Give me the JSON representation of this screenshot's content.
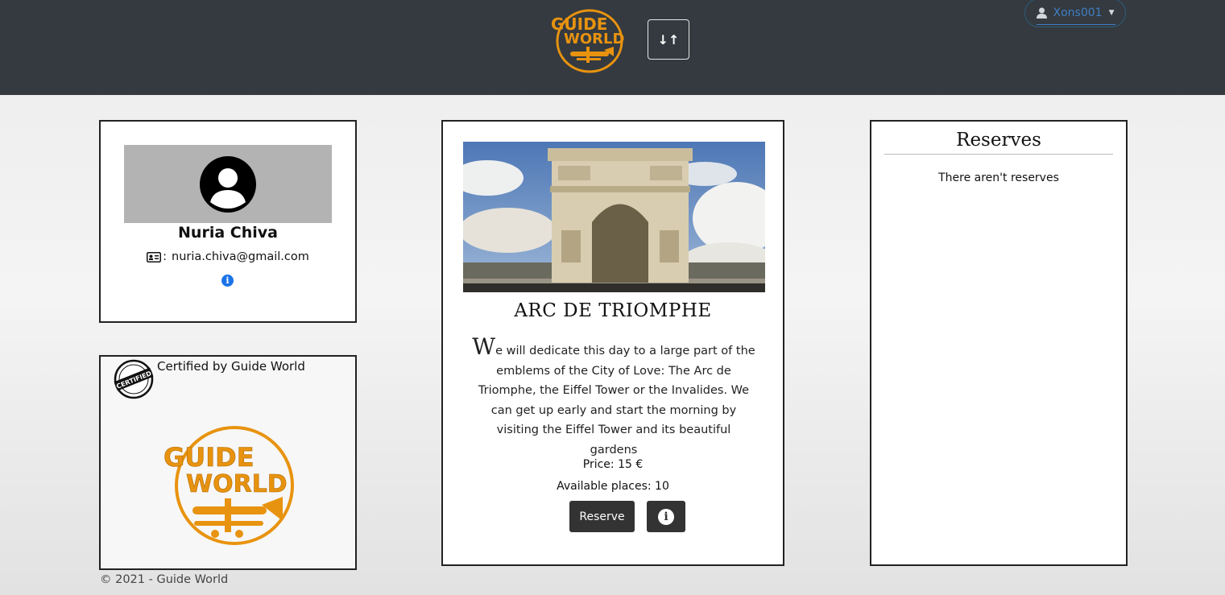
{
  "header": {
    "logo_text_line1": "GUIDE",
    "logo_text_line2": "WORLD",
    "sort_button_label": "↓↑",
    "user_menu_label": "Xons001"
  },
  "profile": {
    "name": "Nuria Chiva",
    "email": "nuria.chiva@gmail.com",
    "email_icon_suffix": ":",
    "info_icon": "i"
  },
  "certificate": {
    "badge_text": "CERTIFIED",
    "title": "Certified by Guide World",
    "logo_text_line1": "GUIDE",
    "logo_text_line2": "WORLD"
  },
  "tour": {
    "title": "ARC DE TRIOMPHE",
    "description_dropcap": "W",
    "description_rest": "e will dedicate this day to a large part of the emblems of the City of Love: The Arc de Triomphe, the Eiffel Tower or the Invalides. We can get up early and start the morning by visiting the Eiffel Tower and its beautiful gardens",
    "price": "Price: 15 €",
    "available_places": "Available places: 10",
    "reserve_button": "Reserve",
    "info_button_icon": "i"
  },
  "reserves": {
    "title": "Reserves",
    "empty_message": "There aren't reserves"
  },
  "footer": {
    "text": "© 2021 - Guide World"
  },
  "colors": {
    "navbar": "#343a40",
    "brand_orange": "#e8930f",
    "user_menu_text": "#3f7fc2",
    "button_dark": "#333333",
    "info_blue": "#1a73e8"
  },
  "icons": {
    "sort": "sort-arrows-icon",
    "user": "user-icon",
    "avatar": "user-avatar-icon",
    "email": "id-card-icon",
    "info": "info-circle-icon",
    "badge": "certified-stamp-icon",
    "airplane": "biplane-icon"
  }
}
